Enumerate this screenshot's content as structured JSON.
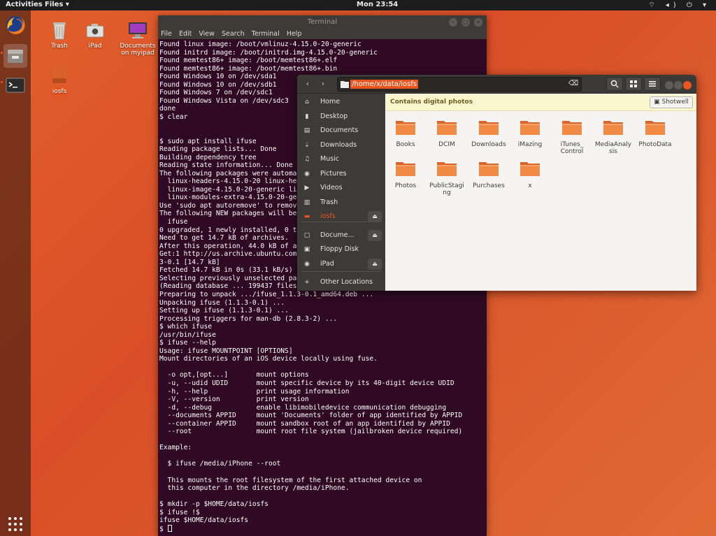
{
  "topbar": {
    "activities": "Activities",
    "app_menu": "Files ▾",
    "clock": "Mon 23:54",
    "system_icons": "⌔ ◂) ⏻ ▾"
  },
  "dock": {
    "items": [
      "firefox-icon",
      "files-icon",
      "terminal-icon",
      "show-apps-icon"
    ]
  },
  "desktop": {
    "icons": [
      {
        "label": "Trash",
        "icon": "trash-icon"
      },
      {
        "label": "iPad",
        "icon": "camera-icon"
      },
      {
        "label": "Documents on myipad",
        "icon": "computer-icon"
      },
      {
        "label": "iosfs",
        "icon": "drive-icon",
        "selected": true
      }
    ]
  },
  "terminal": {
    "title": "Terminal",
    "menu": [
      "File",
      "Edit",
      "View",
      "Search",
      "Terminal",
      "Help"
    ],
    "lines": [
      "Found linux image: /boot/vmlinuz-4.15.0-20-generic",
      "Found initrd image: /boot/initrd.img-4.15.0-20-generic",
      "Found memtest86+ image: /boot/memtest86+.elf",
      "Found memtest86+ image: /boot/memtest86+.bin",
      "Found Windows 10 on /dev/sda1",
      "Found Windows 10 on /dev/sdb1",
      "Found Windows 7 on /dev/sdc1",
      "Found Windows Vista on /dev/sdc3",
      "done",
      "$ clear",
      "",
      "",
      "$ sudo apt install ifuse",
      "Reading package lists... Done",
      "Building dependency tree",
      "Reading state information... Done",
      "The following packages were automat",
      "  linux-headers-4.15.0-20 linux-hea",
      "  linux-image-4.15.0-20-generic lin",
      "  linux-modules-extra-4.15.0-20-gen",
      "Use 'sudo apt autoremove' to remove",
      "The following NEW packages will be",
      "  ifuse",
      "0 upgraded, 1 newly installed, 0 to",
      "Need to get 14.7 kB of archives.",
      "After this operation, 44.0 kB of ad",
      "Get:1 http://us.archive.ubuntu.com/",
      "3-0.1 [14.7 kB]",
      "Fetched 14.7 kB in 0s (33.1 kB/s)",
      "Selecting previously unselected pac",
      "(Reading database ... 199437 files",
      "Preparing to unpack .../ifuse_1.1.3-0.1_amd64.deb ...",
      "Unpacking ifuse (1.1.3-0.1) ...",
      "Setting up ifuse (1.1.3-0.1) ...",
      "Processing triggers for man-db (2.8.3-2) ...",
      "$ which ifuse",
      "/usr/bin/ifuse",
      "$ ifuse --help",
      "Usage: ifuse MOUNTPOINT [OPTIONS]",
      "Mount directories of an iOS device locally using fuse.",
      "",
      "  -o opt,[opt...]       mount options",
      "  -u, --udid UDID       mount specific device by its 40-digit device UDID",
      "  -h, --help            print usage information",
      "  -V, --version         print version",
      "  -d, --debug           enable libimobiledevice communication debugging",
      "  --documents APPID     mount 'Documents' folder of app identified by APPID",
      "  --container APPID     mount sandbox root of an app identified by APPID",
      "  --root                mount root file system (jailbroken device required)",
      "",
      "Example:",
      "",
      "  $ ifuse /media/iPhone --root",
      "",
      "  This mounts the root filesystem of the first attached device on",
      "  this computer in the directory /media/iPhone.",
      "",
      "$ mkdir -p $HOME/data/iosfs",
      "$ ifuse !$",
      "ifuse $HOME/data/iosfs",
      "$ "
    ]
  },
  "files": {
    "path": "/home/x/data/iosfs",
    "sidebar": [
      {
        "label": "Home",
        "icon": "home-icon"
      },
      {
        "label": "Desktop",
        "icon": "desktop-icon"
      },
      {
        "label": "Documents",
        "icon": "documents-icon"
      },
      {
        "label": "Downloads",
        "icon": "downloads-icon"
      },
      {
        "label": "Music",
        "icon": "music-icon"
      },
      {
        "label": "Pictures",
        "icon": "pictures-icon"
      },
      {
        "label": "Videos",
        "icon": "videos-icon"
      },
      {
        "label": "Trash",
        "icon": "trash-icon"
      },
      {
        "label": "iosfs",
        "icon": "drive-icon",
        "active": true,
        "eject": true
      },
      {
        "label": "Docume...",
        "icon": "device-icon",
        "eject": true
      },
      {
        "label": "Floppy Disk",
        "icon": "floppy-icon"
      },
      {
        "label": "iPad",
        "icon": "camera-icon",
        "eject": true
      },
      {
        "label": "Other Locations",
        "icon": "plus-icon"
      }
    ],
    "infobar": {
      "text": "Contains digital photos",
      "button": "Shotwell"
    },
    "folders": [
      [
        "Books"
      ],
      [
        "DCIM"
      ],
      [
        "Downloads"
      ],
      [
        "iMazing"
      ],
      [
        "iTunes_",
        "Control"
      ],
      [
        "MediaAnaly",
        "sis"
      ],
      [
        "PhotoData"
      ],
      [
        "Photos"
      ],
      [
        "PublicStagi",
        "ng"
      ],
      [
        "Purchases"
      ],
      [
        "x"
      ]
    ]
  },
  "colors": {
    "accent": "#e95420",
    "terminal_bg": "#300a24",
    "folder": "#f08a45"
  }
}
